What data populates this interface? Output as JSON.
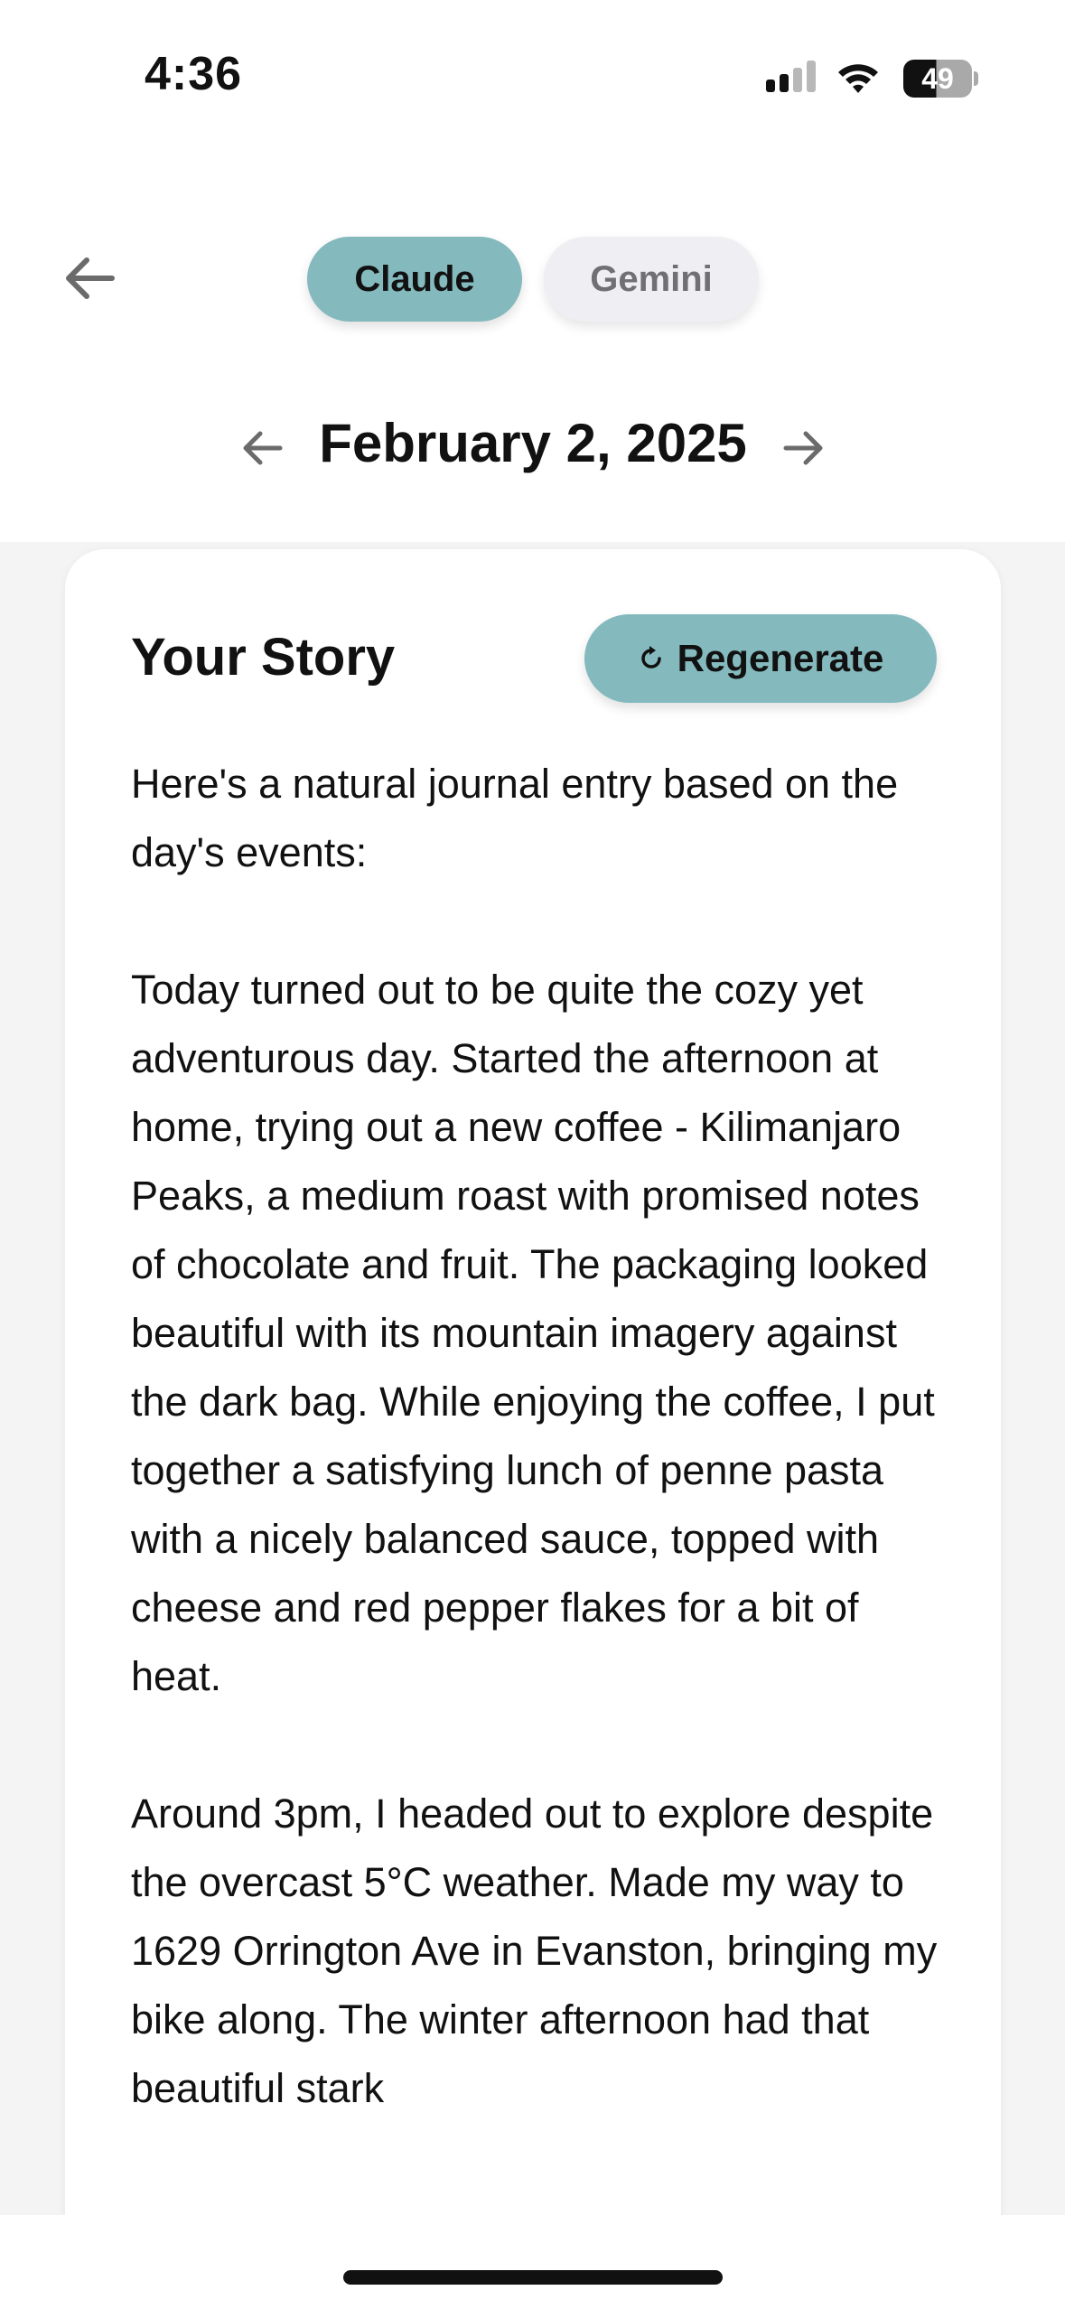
{
  "status_bar": {
    "time": "4:36",
    "battery": "49",
    "icons": [
      "signal-icon",
      "wifi-icon",
      "battery-icon"
    ]
  },
  "header": {
    "back_icon": "arrow-left-icon",
    "tabs": [
      {
        "label": "Claude",
        "selected": true
      },
      {
        "label": "Gemini",
        "selected": false
      }
    ],
    "date": "February 2, 2025",
    "prev_icon": "arrow-left-icon",
    "next_icon": "arrow-right-icon"
  },
  "card": {
    "title": "Your Story",
    "regenerate": {
      "label": "Regenerate",
      "icon": "refresh-icon"
    },
    "paragraphs": [
      "Here's a natural journal entry based on the day's events:",
      "Today turned out to be quite the cozy yet adventurous day. Started the afternoon at home, trying out a new coffee - Kilimanjaro Peaks, a medium roast with promised notes of chocolate and fruit. The packaging looked beautiful with its mountain imagery against the dark bag. While enjoying the coffee, I put together a satisfying lunch of penne pasta with a nicely balanced sauce, topped with cheese and red pepper flakes for a bit of heat.",
      "Around 3pm, I headed out to explore despite the overcast 5°C weather. Made my way to 1629 Orrington Ave in Evanston, bringing my bike along. The winter afternoon had that beautiful stark"
    ]
  },
  "colors": {
    "accent": "#84b9be",
    "tab_inactive": "#efeff3",
    "page_background": "#f4f4f5"
  }
}
